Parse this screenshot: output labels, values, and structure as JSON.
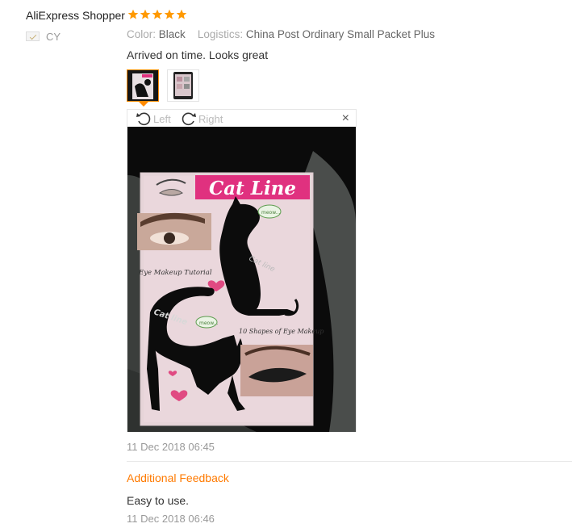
{
  "reviewer": {
    "name": "AliExpress Shopper",
    "country": "CY",
    "stars": 5,
    "star_color": "#ff9900"
  },
  "attributes": {
    "color_key": "Color:",
    "color_value": "Black",
    "logistics_key": "Logistics:",
    "logistics_value": "China Post Ordinary Small Packet Plus"
  },
  "review": {
    "text": "Arrived on time. Looks great",
    "date": "11 Dec 2018 06:45"
  },
  "viewer": {
    "rotate_left": "Left",
    "rotate_right": "Right",
    "close": "×",
    "photo": {
      "banner": "Cat Line",
      "caption_left": "Eye Makeup Tutorial",
      "caption_right": "10 Shapes of Eye Makeup",
      "cat_label_1": "Cat line",
      "cat_label_2": "Cat line",
      "meow_1": "meow...",
      "meow_2": "meow..."
    }
  },
  "additional": {
    "title": "Additional Feedback",
    "text": "Easy to use.",
    "date": "11 Dec 2018 06:46"
  },
  "colors": {
    "accent": "#ff7a00",
    "banner": "#e0317f"
  }
}
